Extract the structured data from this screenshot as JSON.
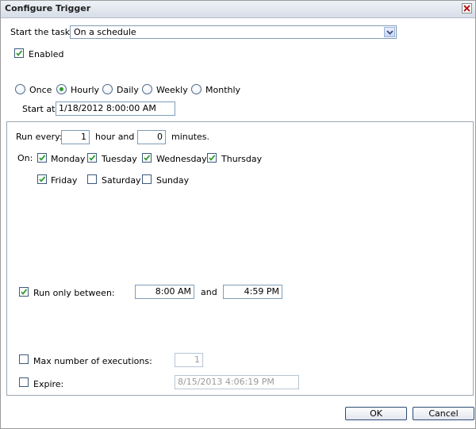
{
  "window": {
    "title": "Configure Trigger"
  },
  "start_task": {
    "label": "Start the task",
    "value": "On a schedule"
  },
  "enabled": {
    "label": "Enabled",
    "checked": true
  },
  "frequency": {
    "options": [
      "Once",
      "Hourly",
      "Daily",
      "Weekly",
      "Monthly"
    ],
    "selected": "Hourly"
  },
  "start_at": {
    "label": "Start at:",
    "value": "1/18/2012 8:00:00 AM"
  },
  "run_every": {
    "label": "Run every:",
    "hours": "1",
    "hour_and_label": "hour and",
    "minutes": "0",
    "minutes_label": "minutes."
  },
  "on_days": {
    "label": "On:",
    "days": [
      {
        "name": "Monday",
        "checked": true
      },
      {
        "name": "Tuesday",
        "checked": true
      },
      {
        "name": "Wednesday",
        "checked": true
      },
      {
        "name": "Thursday",
        "checked": true
      },
      {
        "name": "Friday",
        "checked": true
      },
      {
        "name": "Saturday",
        "checked": false
      },
      {
        "name": "Sunday",
        "checked": false
      }
    ]
  },
  "run_only_between": {
    "label": "Run only between:",
    "checked": true,
    "from": "8:00 AM",
    "and_label": "and",
    "to": "4:59 PM"
  },
  "max_executions": {
    "label": "Max number of executions:",
    "checked": false,
    "value": "1"
  },
  "expire": {
    "label": "Expire:",
    "checked": false,
    "value": "8/15/2013 4:06:19 PM"
  },
  "buttons": {
    "ok": "OK",
    "cancel": "Cancel"
  },
  "colors": {
    "checkmark": "#2f9b2f",
    "radio_dot": "#2f9b2f",
    "border": "#7f9db9"
  }
}
